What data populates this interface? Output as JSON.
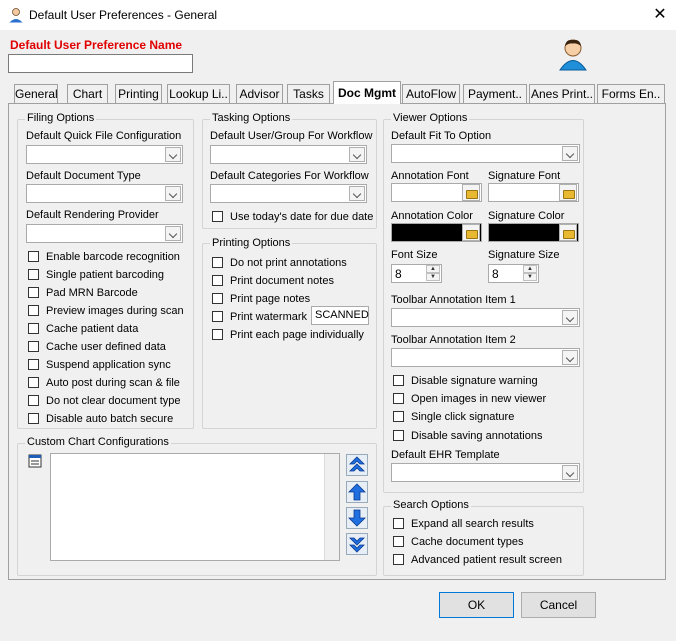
{
  "window": {
    "title": "Default User Preferences - General",
    "close_symbol": "✕"
  },
  "header": {
    "pref_label": "Default User Preference Name",
    "pref_value": ""
  },
  "tabs": [
    {
      "label": "General"
    },
    {
      "label": "Chart"
    },
    {
      "label": "Printing"
    },
    {
      "label": "Lookup Li.."
    },
    {
      "label": "Advisor"
    },
    {
      "label": "Tasks"
    },
    {
      "label": "Doc Mgmt"
    },
    {
      "label": "AutoFlow"
    },
    {
      "label": "Payment.."
    },
    {
      "label": "Anes Print.."
    },
    {
      "label": "Forms En.."
    }
  ],
  "active_tab": "Doc Mgmt",
  "filing": {
    "title": "Filing Options",
    "quick_file_label": "Default Quick File Configuration",
    "doc_type_label": "Default Document Type",
    "rendering_label": "Default Rendering Provider",
    "checkboxes": [
      {
        "label": "Enable barcode recognition",
        "checked": false
      },
      {
        "label": "Single patient barcoding",
        "checked": false
      },
      {
        "label": "Pad MRN Barcode",
        "checked": false
      },
      {
        "label": "Preview images during scan",
        "checked": false
      },
      {
        "label": "Cache patient data",
        "checked": false
      },
      {
        "label": "Cache user defined data",
        "checked": false
      },
      {
        "label": "Suspend application sync",
        "checked": false
      },
      {
        "label": "Auto post during scan & file",
        "checked": false
      },
      {
        "label": "Do not clear document type",
        "checked": false
      },
      {
        "label": "Disable auto batch secure",
        "checked": false
      }
    ]
  },
  "tasking": {
    "title": "Tasking Options",
    "user_group_label": "Default User/Group For Workflow",
    "categories_label": "Default Categories For Workflow",
    "today_label": "Use today's date for due date"
  },
  "printing": {
    "title": "Printing Options",
    "checkboxes": [
      {
        "label": "Do not print annotations",
        "checked": false
      },
      {
        "label": "Print document notes",
        "checked": false
      },
      {
        "label": "Print page notes",
        "checked": false
      },
      {
        "label": "Print watermark",
        "checked": false
      },
      {
        "label": "Print each page individually",
        "checked": false
      }
    ],
    "watermark_value": "SCANNED"
  },
  "viewer": {
    "title": "Viewer Options",
    "fit_label": "Default Fit To Option",
    "annotation_font_label": "Annotation Font",
    "signature_font_label": "Signature Font",
    "annotation_color_label": "Annotation Color",
    "signature_color_label": "Signature Color",
    "annotation_color": "#000000",
    "signature_color": "#000000",
    "font_size_label": "Font Size",
    "signature_size_label": "Signature Size",
    "font_size_value": "8",
    "signature_size_value": "8",
    "toolbar1_label": "Toolbar Annotation Item 1",
    "toolbar2_label": "Toolbar Annotation Item 2",
    "checkboxes": [
      {
        "label": "Disable signature warning",
        "checked": false
      },
      {
        "label": "Open images in new viewer",
        "checked": false
      },
      {
        "label": "Single click signature",
        "checked": false
      },
      {
        "label": "Disable saving annotations",
        "checked": false
      }
    ],
    "ehr_label": "Default EHR Template"
  },
  "search": {
    "title": "Search Options",
    "checkboxes": [
      {
        "label": "Expand all search results",
        "checked": false
      },
      {
        "label": "Cache document types",
        "checked": false
      },
      {
        "label": "Advanced patient result screen",
        "checked": false
      }
    ]
  },
  "custom_chart": {
    "title": "Custom Chart Configurations"
  },
  "footer": {
    "ok_label": "OK",
    "cancel_label": "Cancel"
  }
}
